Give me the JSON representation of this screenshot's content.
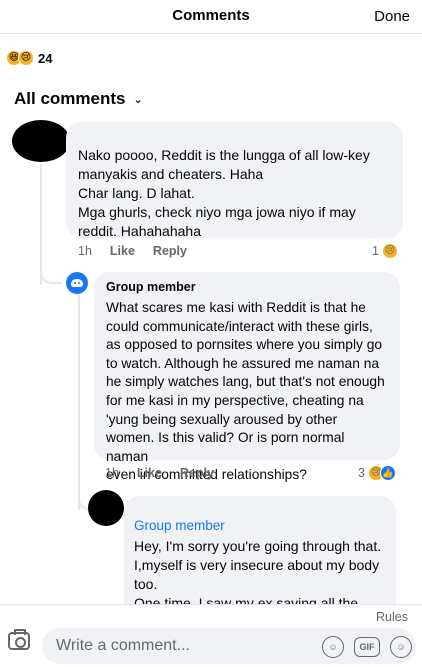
{
  "header": {
    "title": "Comments",
    "done_label": "Done"
  },
  "reactions": {
    "count": "24"
  },
  "section": {
    "label": "All comments"
  },
  "comments": [
    {
      "text": "Nako poooo, Reddit is the lungga of all low-key\nmanyakis and cheaters. Haha\nChar lang. D lahat.\nMga ghurls, check niyo mga jowa niyo if may\nreddit. Hahahahaha",
      "time": "1h",
      "like": "Like",
      "reply": "Reply",
      "reactions": "1"
    },
    {
      "author": "Group member",
      "text": "What scares me kasi with Reddit is that he\ncould communicate/interact with these girls,\nas opposed to pornsites where you simply go\nto watch. Although he assured me naman na\nhe simply watches lang, but that's not enough\nfor me kasi in my perspective, cheating na\n'yung being sexually aroused by other\nwomen. Is this valid? Or is porn normal naman\neven in committed relationships?",
      "time": "1h",
      "like": "Like",
      "reply": "Reply",
      "reactions": "3"
    },
    {
      "author": "Group member",
      "text": "Hey, I'm sorry you're going through that.\nI,myself is very insecure about my body\ntoo.\nOne time, I saw my ex saving all the"
    }
  ],
  "footer": {
    "rules": "Rules",
    "placeholder": "Write a comment...",
    "gif_label": "GIF"
  }
}
